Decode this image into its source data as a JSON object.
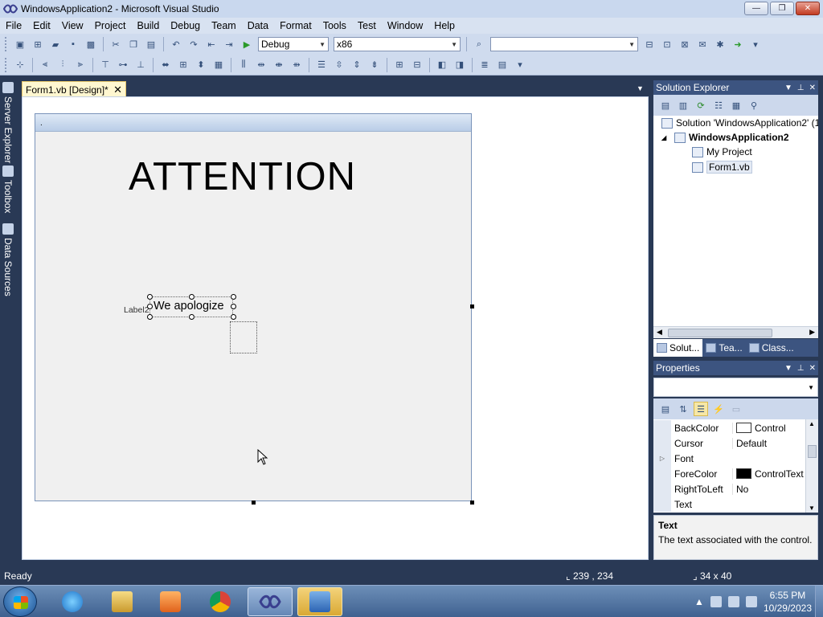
{
  "window": {
    "title": "WindowsApplication2 - Microsoft Visual Studio",
    "minimize": "—",
    "maximize": "❐",
    "close": "✕"
  },
  "menu": [
    "File",
    "Edit",
    "View",
    "Project",
    "Build",
    "Debug",
    "Team",
    "Data",
    "Format",
    "Tools",
    "Test",
    "Window",
    "Help"
  ],
  "toolbar": {
    "config": "Debug",
    "platform": "x86",
    "find_value": ""
  },
  "side_tabs": [
    "Server Explorer",
    "Toolbox",
    "Data Sources"
  ],
  "document_tab": {
    "label": "Form1.vb [Design]*",
    "close": "✕"
  },
  "form": {
    "caption": ".",
    "attention_text": "ATTENTION",
    "label_name": "Label2",
    "label_text": "We apologize"
  },
  "solution_explorer": {
    "title": "Solution Explorer",
    "solution": "Solution 'WindowsApplication2' (1 project)",
    "project": "WindowsApplication2",
    "my_project": "My Project",
    "form_file": "Form1.vb",
    "tabs": [
      "Solut...",
      "Tea...",
      "Class..."
    ]
  },
  "properties": {
    "title": "Properties",
    "rows": [
      {
        "name": "BackColor",
        "value": "Control",
        "swatch": "#ffffff",
        "expand": ""
      },
      {
        "name": "Cursor",
        "value": "Default",
        "swatch": "",
        "expand": ""
      },
      {
        "name": "Font",
        "value": "",
        "swatch": "",
        "expand": "▷"
      },
      {
        "name": "ForeColor",
        "value": "ControlText",
        "swatch": "#000000",
        "expand": ""
      },
      {
        "name": "RightToLeft",
        "value": "No",
        "swatch": "",
        "expand": ""
      },
      {
        "name": "Text",
        "value": "",
        "swatch": "",
        "expand": ""
      }
    ],
    "desc_title": "Text",
    "desc_text": "The text associated with the control."
  },
  "status": {
    "ready": "Ready",
    "position": "239 , 234",
    "size": "34 x 40"
  },
  "taskbar": {
    "time": "6:55 PM",
    "date": "10/29/2023"
  },
  "colors": {
    "chrome": "#293955",
    "panel_header": "#3c5480",
    "doc_tab": "#fff7d0"
  }
}
